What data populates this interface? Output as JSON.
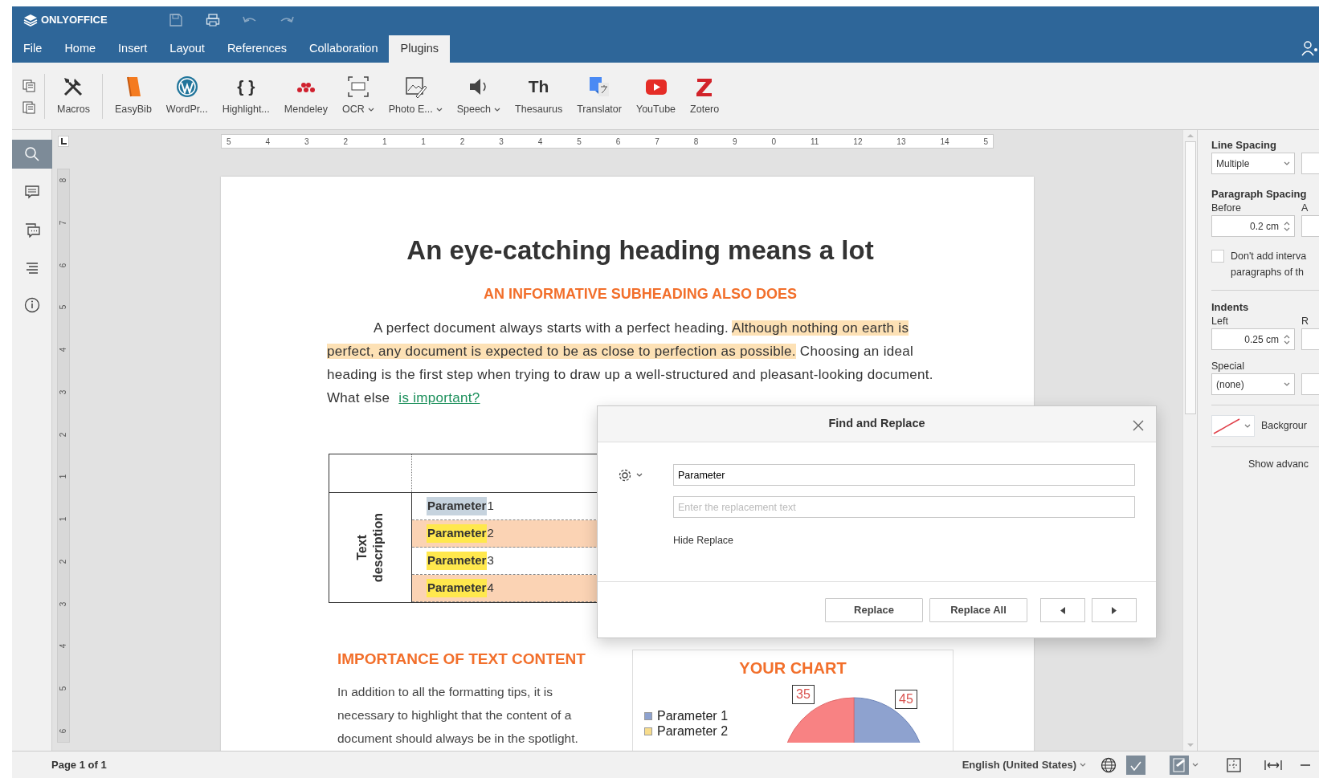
{
  "app": {
    "logo_text": "ONLYOFFICE"
  },
  "menu_tabs": [
    {
      "label": "File",
      "selected": false
    },
    {
      "label": "Home",
      "selected": false
    },
    {
      "label": "Insert",
      "selected": false
    },
    {
      "label": "Layout",
      "selected": false
    },
    {
      "label": "References",
      "selected": false
    },
    {
      "label": "Collaboration",
      "selected": false
    },
    {
      "label": "Plugins",
      "selected": true
    }
  ],
  "toolbar": {
    "macros": {
      "label": "Macros"
    },
    "plugins": [
      {
        "label": "EasyBib",
        "dropdown": false
      },
      {
        "label": "WordPr...",
        "dropdown": false
      },
      {
        "label": "Highlight...",
        "dropdown": false,
        "glyph": "{ }"
      },
      {
        "label": "Mendeley",
        "dropdown": false
      },
      {
        "label": "OCR",
        "dropdown": true
      },
      {
        "label": "Photo E...",
        "dropdown": true
      },
      {
        "label": "Speech",
        "dropdown": true
      },
      {
        "label": "Thesaurus",
        "dropdown": false,
        "glyph": "Th"
      },
      {
        "label": "Translator",
        "dropdown": false
      },
      {
        "label": "YouTube",
        "dropdown": false
      },
      {
        "label": "Zotero",
        "dropdown": false
      }
    ]
  },
  "left_sidebar": [
    {
      "kind": "search",
      "selected": true
    },
    {
      "kind": "comments",
      "selected": false
    },
    {
      "kind": "chat",
      "selected": false
    },
    {
      "kind": "navigation",
      "selected": false
    },
    {
      "kind": "about",
      "selected": false
    }
  ],
  "rulers": {
    "horizontal": [
      "5",
      "4",
      "3",
      "2",
      "1",
      "1",
      "2",
      "3",
      "4",
      "5",
      "6",
      "7",
      "8",
      "9",
      "0",
      "11",
      "12",
      "13",
      "14",
      "5"
    ],
    "vertical": [
      "8",
      "7",
      "6",
      "5",
      "4",
      "3",
      "2",
      "1",
      "1",
      "2",
      "3",
      "4",
      "5",
      "6"
    ]
  },
  "document": {
    "heading": "An eye-catching heading means a lot",
    "subheading": "AN INFORMATIVE SUBHEADING ALSO DOES",
    "paragraph": [
      {
        "text": "A perfect document always starts with a perfect heading. ",
        "highlighted": false
      },
      {
        "text": "Although nothing on earth is perfect, any document is expected to be as close to perfection as possible.",
        "highlighted": true
      },
      {
        "text": " Choosing an ideal heading is the first step when trying to draw up a well-structured and pleasant-looking document. What else ",
        "highlighted": false
      }
    ],
    "link": "is important?",
    "table": {
      "side_label": "Text description",
      "rows": [
        {
          "term": "Parameter",
          "suffix": "1",
          "shaded": false,
          "current": true
        },
        {
          "term": "Parameter",
          "suffix": "2",
          "shaded": true,
          "current": false
        },
        {
          "term": "Parameter",
          "suffix": "3",
          "shaded": false,
          "current": false
        },
        {
          "term": "Parameter",
          "suffix": "4",
          "shaded": true,
          "current": false
        }
      ]
    },
    "section_heading": "IMPORTANCE OF TEXT CONTENT",
    "section_text": "In addition to all the formatting tips, it is necessary to highlight that the content of a document should always be in the spotlight.",
    "chart": {
      "title": "YOUR CHART",
      "value_labels": [
        "35",
        "45"
      ],
      "legend": [
        {
          "label": "Parameter 1",
          "color": "#8ea2cf"
        },
        {
          "label": "Parameter 2",
          "color": "#f7dc8c"
        }
      ]
    }
  },
  "find_replace": {
    "title": "Find and Replace",
    "find_value": "Parameter",
    "replace_placeholder": "Enter the replacement text",
    "hide_replace": "Hide Replace",
    "buttons": [
      "Replace",
      "Replace All"
    ]
  },
  "paragraph_settings": {
    "line_spacing_label": "Line Spacing",
    "line_spacing_value": "Multiple",
    "paragraph_spacing_label": "Paragraph Spacing",
    "before_label": "Before",
    "after_label": "A",
    "before_value": "0.2 cm",
    "dont_add_checked": false,
    "dont_add_lines": [
      "Don't add interva",
      "paragraphs of th"
    ],
    "indents_label": "Indents",
    "left_label": "Left",
    "right_label": "R",
    "left_value": "0.25 cm",
    "special_label": "Special",
    "special_value": "(none)",
    "background_label": "Backgrour",
    "show_advanced": "Show advanc"
  },
  "status_bar": {
    "page": "Page 1 of 1",
    "language": "English (United States)"
  }
}
